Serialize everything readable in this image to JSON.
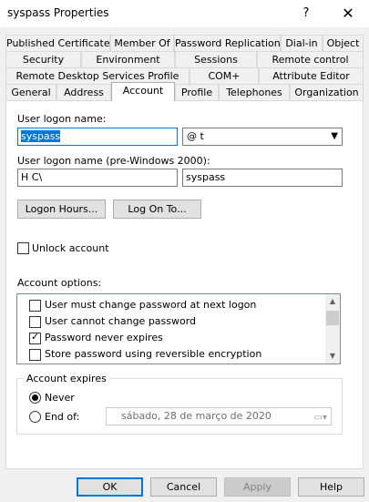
{
  "window": {
    "title": "syspass Properties",
    "help_glyph": "?",
    "close_glyph": "✕"
  },
  "tabs": {
    "row1": [
      "Published Certificates",
      "Member Of",
      "Password Replication",
      "Dial-in",
      "Object"
    ],
    "row2": [
      "Security",
      "Environment",
      "Sessions",
      "Remote control"
    ],
    "row3": [
      "Remote Desktop Services Profile",
      "COM+",
      "Attribute Editor"
    ],
    "row4": [
      "General",
      "Address",
      "Account",
      "Profile",
      "Telephones",
      "Organization"
    ],
    "active": "Account"
  },
  "account": {
    "logon_name_label": "User logon name:",
    "logon_name_value": "syspass",
    "domain_value": "@           t",
    "pre2000_label": "User logon name (pre-Windows 2000):",
    "pre2000_domain": "H      C\\",
    "pre2000_user": "syspass",
    "logon_hours_button": "Logon Hours...",
    "logon_on_to_button": "Log On To...",
    "unlock_label": "Unlock account",
    "unlock_checked": false,
    "options_label": "Account options:",
    "options": [
      {
        "label": "User must change password at next logon",
        "checked": false
      },
      {
        "label": "User cannot change password",
        "checked": false
      },
      {
        "label": "Password never expires",
        "checked": true
      },
      {
        "label": "Store password using reversible encryption",
        "checked": false
      }
    ],
    "expires_label": "Account expires",
    "never_label": "Never",
    "end_of_label": "End of:",
    "expires_selected": "Never",
    "date_day": "sábado",
    "date_rest": ",  28 de     março     de 2020"
  },
  "buttons": {
    "ok": "OK",
    "cancel": "Cancel",
    "apply": "Apply",
    "help": "Help"
  },
  "colors": {
    "accent": "#0078d7",
    "window_bg": "#f0f0f0"
  }
}
